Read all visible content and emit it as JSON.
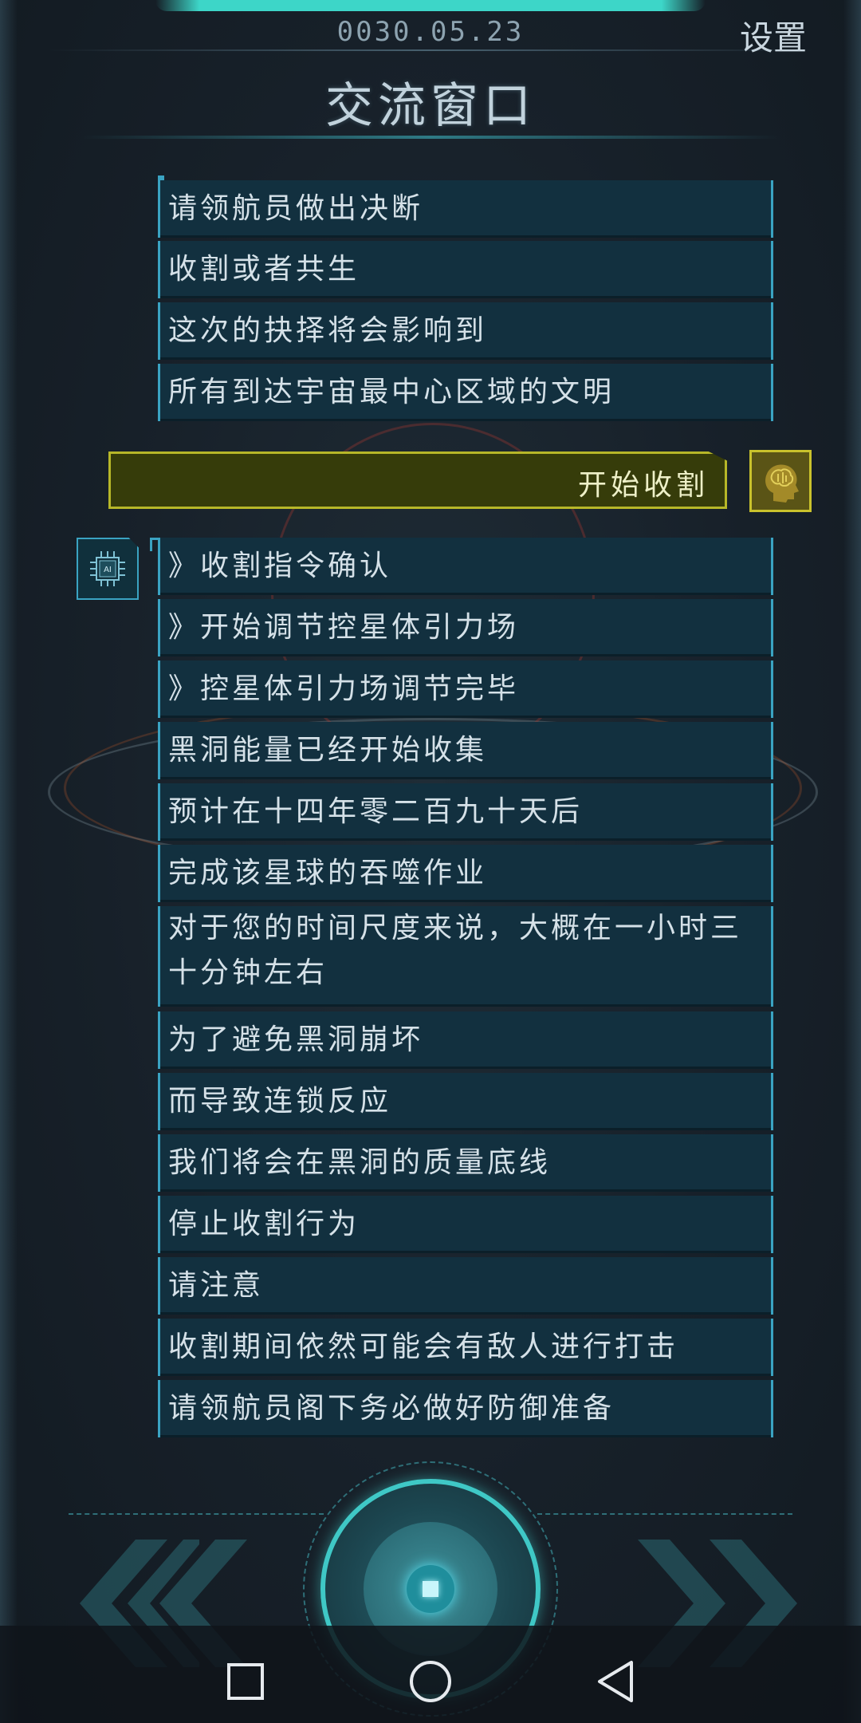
{
  "header": {
    "date": "0030.05.23",
    "settings_label": "设置",
    "title": "交流窗口"
  },
  "messages_top": [
    "请领航员做出决断",
    "收割或者共生",
    "这次的抉择将会影响到",
    "所有到达宇宙最中心区域的文明"
  ],
  "user_reply": "开始收割",
  "ai_avatar_label": "AI",
  "messages_bottom": [
    "》收割指令确认",
    "》开始调节控星体引力场",
    "》控星体引力场调节完毕",
    "黑洞能量已经开始收集",
    "预计在十四年零二百九十天后",
    "完成该星球的吞噬作业",
    "对于您的时间尺度来说，大概在一小时三十分钟左右",
    "为了避免黑洞崩坏",
    "而导致连锁反应",
    "我们将会在黑洞的质量底线",
    "停止收割行为",
    "请注意",
    "收割期间依然可能会有敌人进行打击",
    "请领航员阁下务必做好防御准备"
  ],
  "controls": {
    "prev_icon": "double-chevron-left-icon",
    "next_icon": "double-chevron-right-icon",
    "main_icon": "confirm-core-icon"
  },
  "navbar": {
    "recent_icon": "square-icon",
    "home_icon": "circle-icon",
    "back_icon": "triangle-back-icon"
  },
  "colors": {
    "accent": "#3fc8c6",
    "message_bg": "#12303f",
    "message_border": "#3aa3c2",
    "user_bg": "#363c0a",
    "user_border": "#b7b728"
  }
}
